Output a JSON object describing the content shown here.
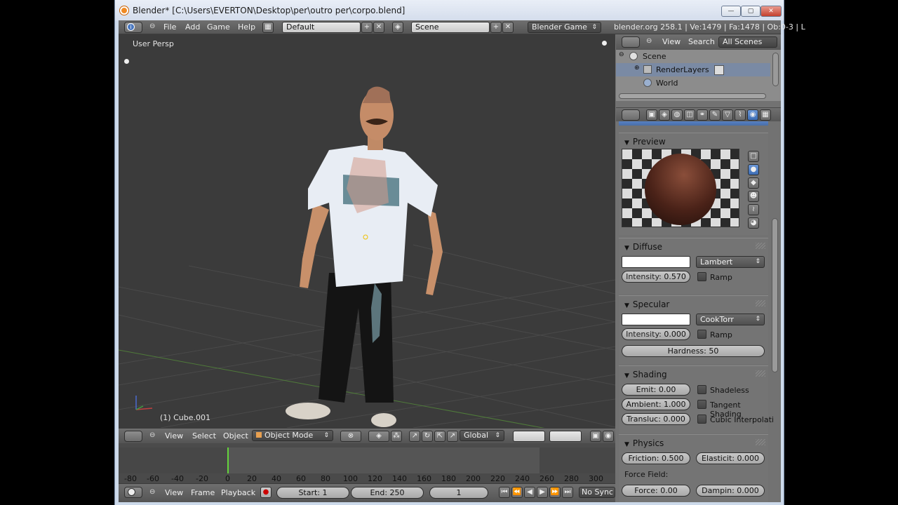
{
  "window": {
    "title": "Blender* [C:\\Users\\EVERTON\\Desktop\\per\\outro per\\corpo.blend]",
    "minimize": "—",
    "maximize": "▢",
    "close": "✕"
  },
  "info_header": {
    "menus": [
      "File",
      "Add",
      "Game",
      "Help"
    ],
    "layout": "Default",
    "scene": "Scene",
    "engine": "Blender Game",
    "stats": "blender.org 258.1 | Ve:1479 | Fa:1478 | Ob:0-3 | L"
  },
  "viewport": {
    "view_label": "User Persp",
    "object_label": "(1) Cube.001"
  },
  "view3d_header": {
    "menus": [
      "View",
      "Select",
      "Object"
    ],
    "mode": "Object Mode",
    "orientation": "Global"
  },
  "timeline": {
    "ticks": [
      "-80",
      "-60",
      "-40",
      "-20",
      "0",
      "20",
      "40",
      "60",
      "80",
      "100",
      "120",
      "140",
      "160",
      "180",
      "200",
      "220",
      "240",
      "260",
      "280",
      "300"
    ],
    "current_frame_marker": 0,
    "menus": [
      "View",
      "Frame",
      "Playback"
    ],
    "start": "Start: 1",
    "end": "End: 250",
    "frame": "1",
    "sync": "No Sync"
  },
  "outliner": {
    "menus": [
      "View",
      "Search"
    ],
    "filter": "All Scenes",
    "items": [
      {
        "label": "Scene"
      },
      {
        "label": "RenderLayers"
      },
      {
        "label": "World"
      }
    ]
  },
  "properties": {
    "preview": {
      "title": "Preview"
    },
    "diffuse": {
      "title": "Diffuse",
      "shader": "Lambert",
      "intensity_label": "Intensity:",
      "intensity": "0.570",
      "ramp": "Ramp"
    },
    "specular": {
      "title": "Specular",
      "shader": "CookTorr",
      "intensity_label": "Intensity:",
      "intensity": "0.000",
      "ramp": "Ramp",
      "hardness": "Hardness: 50"
    },
    "shading": {
      "title": "Shading",
      "emit": "Emit: 0.00",
      "ambient": "Ambient: 1.000",
      "transluc": "Transluc: 0.000",
      "shadeless": "Shadeless",
      "tangent": "Tangent Shading",
      "cubic": "Cubic Interpolati"
    },
    "physics": {
      "title": "Physics",
      "friction": "Friction: 0.500",
      "elasticity": "Elasticit: 0.000",
      "force_field": "Force Field:",
      "force": "Force: 0.00",
      "damping": "Dampin: 0.000"
    }
  },
  "colors": {
    "viewport_bg": "#3b3b3b",
    "panel_bg": "#727272",
    "selection": "#5680c2",
    "frame_marker": "#64d33c"
  }
}
